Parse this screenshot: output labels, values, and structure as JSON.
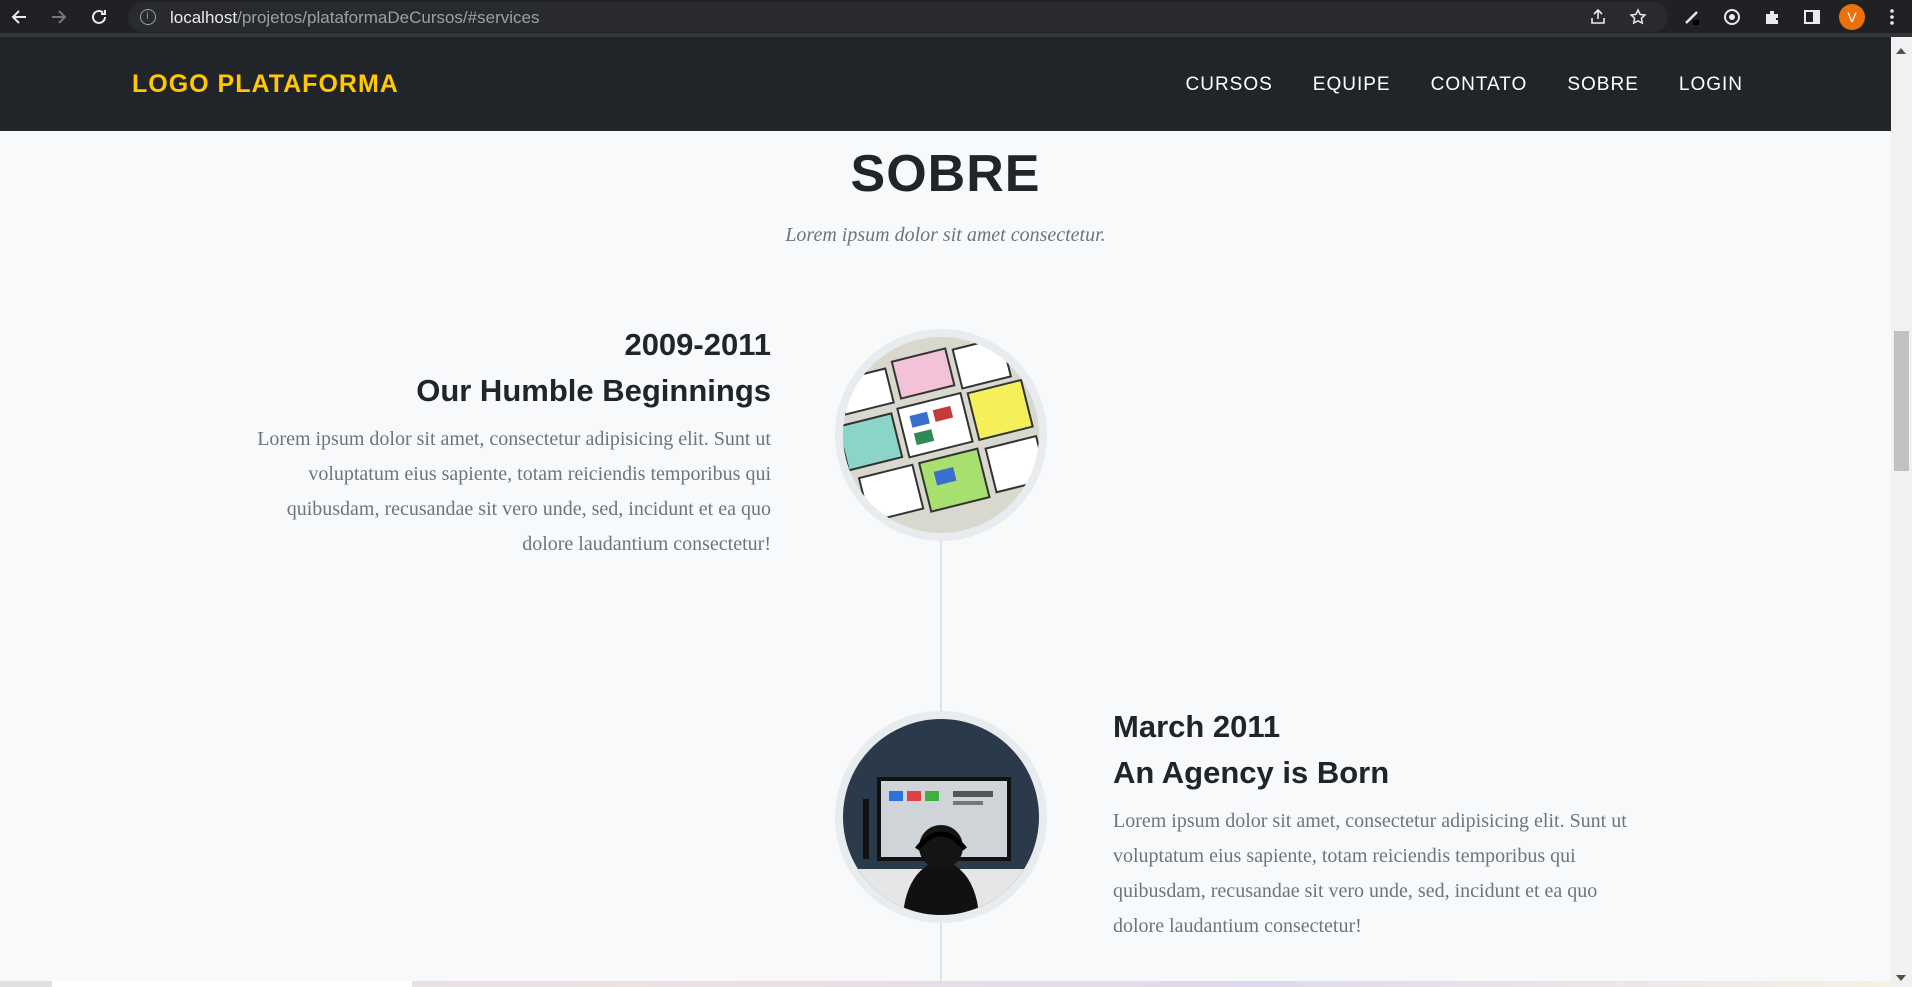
{
  "browser": {
    "url_host": "localhost",
    "url_path": "/projetos/plataformaDeCursos/#services",
    "profile_initial": "V"
  },
  "navbar": {
    "logo": "LOGO PLATAFORMA",
    "items": [
      "CURSOS",
      "EQUIPE",
      "CONTATO",
      "SOBRE",
      "LOGIN"
    ]
  },
  "section": {
    "title": "SOBRE",
    "subtitle": "Lorem ipsum dolor sit amet consectetur."
  },
  "timeline": [
    {
      "date": "2009-2011",
      "heading": "Our Humble Beginnings",
      "body": "Lorem ipsum dolor sit amet, consectetur adipisicing elit. Sunt ut voluptatum eius sapiente, totam reiciendis temporibus qui quibusdam, recusandae sit vero unde, sed, incidunt et ea quo dolore laudantium consectetur!"
    },
    {
      "date": "March 2011",
      "heading": "An Agency is Born",
      "body": "Lorem ipsum dolor sit amet, consectetur adipisicing elit. Sunt ut voluptatum eius sapiente, totam reiciendis temporibus qui quibusdam, recusandae sit vero unde, sed, incidunt et ea quo dolore laudantium consectetur!"
    }
  ],
  "colors": {
    "accent": "#ffc800",
    "navbar_bg": "#212529",
    "page_bg": "#f8f9fa"
  }
}
